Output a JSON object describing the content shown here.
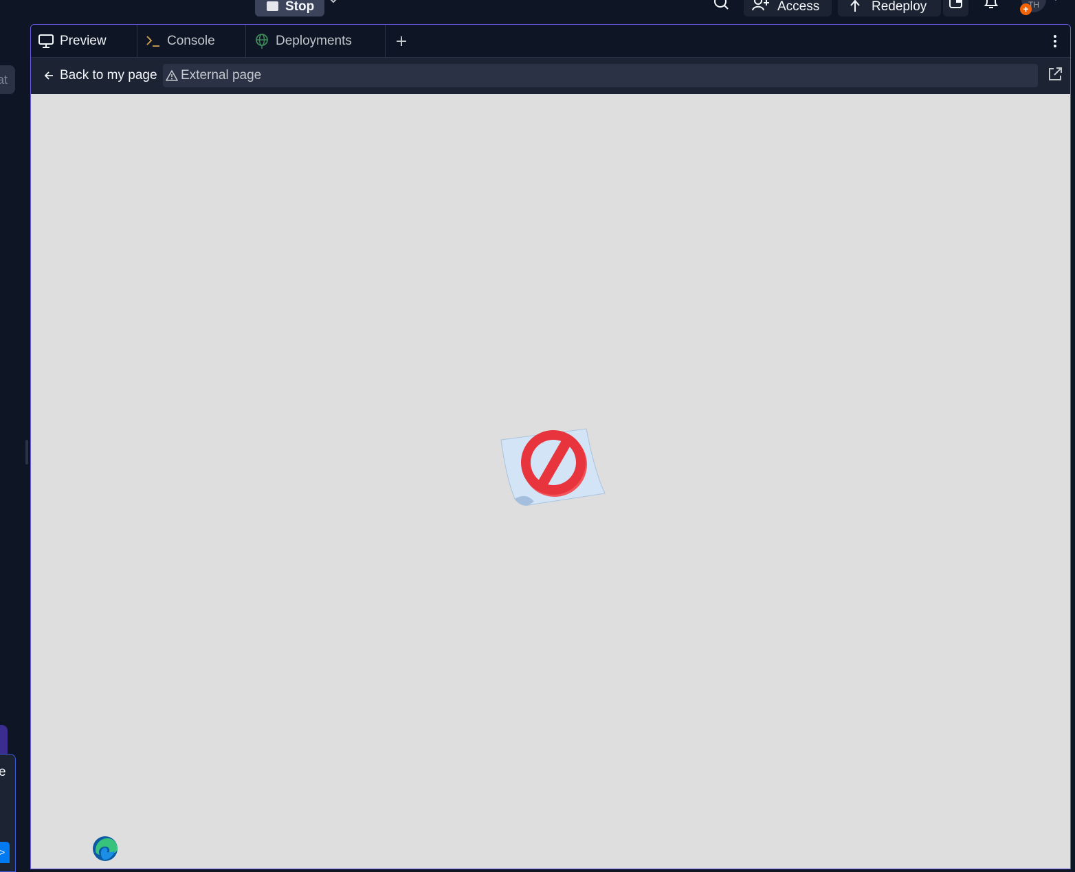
{
  "header": {
    "stop_label": "Stop",
    "access_label": "Access",
    "redeploy_label": "Redeploy",
    "avatar_initials": "TH",
    "avatar_badge": "+"
  },
  "sidebar": {
    "input_fragment": "at",
    "card_fragment": "e",
    "button_fragment": ">"
  },
  "tabs": [
    {
      "label": "Preview",
      "icon": "monitor-icon",
      "active": true
    },
    {
      "label": "Console",
      "icon": "terminal-icon",
      "active": false
    },
    {
      "label": "Deployments",
      "icon": "globe-icon",
      "active": false
    }
  ],
  "preview": {
    "back_label": "Back to my page",
    "url_label": "External page"
  },
  "colors": {
    "background": "#0e1525",
    "surface": "#1c2333",
    "pane_border": "#6c5ce7",
    "viewport_bg": "#dedede",
    "blocked_red": "#e5303a",
    "deploy_icon": "#3d8b5a",
    "console_icon": "#d4a852"
  }
}
